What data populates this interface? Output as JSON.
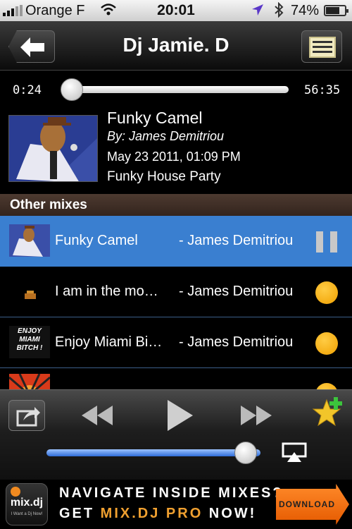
{
  "status_bar": {
    "carrier": "Orange F",
    "time": "20:01",
    "battery": "74%"
  },
  "nav": {
    "title": "Dj Jamie. D",
    "back_icon": "arrow-left-icon",
    "list_icon": "list-icon"
  },
  "scrubber": {
    "elapsed": "0:24",
    "total": "56:35",
    "progress": 0.007
  },
  "now_playing": {
    "title": "Funky Camel",
    "by": "By: James Demitriou",
    "date": "May 23 2011, 01:09 PM",
    "album": "Funky House Party"
  },
  "section_title": "Other mixes",
  "mixes": [
    {
      "name": "Funky Camel",
      "artist": "- James Demitriou",
      "state": "playing",
      "art_text": ""
    },
    {
      "name": "I am in the mo…",
      "artist": "- James Demitriou",
      "state": "idle",
      "art_text": ""
    },
    {
      "name": "Enjoy Miami Bi…",
      "artist": "- James Demitriou",
      "state": "idle",
      "art_text": "ENJOY MIAMI BITCH !"
    },
    {
      "name": "",
      "artist": "",
      "state": "idle",
      "art_text": ""
    }
  ],
  "player": {
    "volume": 0.93
  },
  "ad": {
    "logo_brand": "mix.dj",
    "logo_tagline": "I Want a Dj Now!",
    "line1": "NAVIGATE INSIDE MIXES?",
    "line2_a": "GET ",
    "line2_pro": "MIX.DJ PRO",
    "line2_b": " NOW!",
    "download": "DOWNLOAD"
  },
  "colors": {
    "selected_row": "#3a7fd0",
    "accent_orange": "#f0a000",
    "volume_fill": "#2f6dd8"
  }
}
